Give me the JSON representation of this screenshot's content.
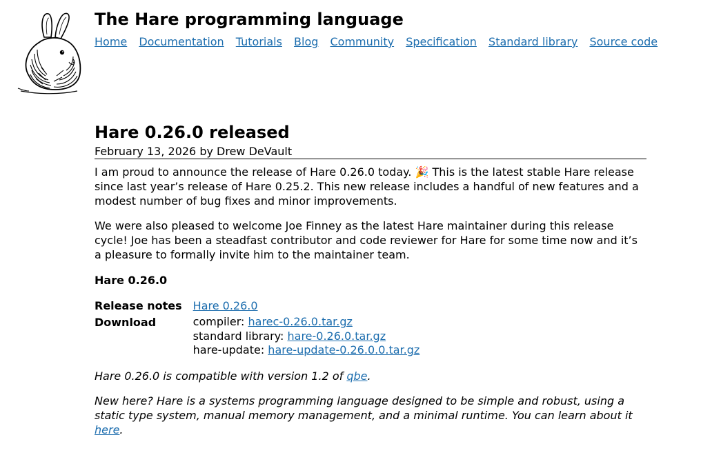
{
  "site": {
    "title": "The Hare programming language",
    "logo_icon": "hare-rabbit-logo"
  },
  "nav": {
    "items": [
      {
        "label": "Home"
      },
      {
        "label": "Documentation"
      },
      {
        "label": "Tutorials"
      },
      {
        "label": "Blog"
      },
      {
        "label": "Community"
      },
      {
        "label": "Specification"
      },
      {
        "label": "Standard library"
      },
      {
        "label": "Source code"
      }
    ]
  },
  "post": {
    "title": "Hare 0.26.0 released",
    "byline": "February 13, 2026 by Drew DeVault",
    "para1": "I am proud to announce the release of Hare 0.26.0 today. 🎉 This is the latest stable Hare release since last year’s release of Hare 0.25.2. This new release includes a handful of new features and a modest number of bug fixes and minor improvements.",
    "para2": "We were also pleased to welcome Joe Finney as the latest Hare maintainer during this release cycle! Joe has been a steadfast contributor and code reviewer for Hare for some time now and it’s a pleasure to formally invite him to the maintainer team.",
    "release_heading": "Hare 0.26.0",
    "release_notes_label": "Release notes",
    "release_notes_link": "Hare 0.26.0",
    "download_label": "Download",
    "downloads": [
      {
        "prefix": "compiler: ",
        "link": "harec-0.26.0.tar.gz"
      },
      {
        "prefix": "standard library: ",
        "link": "hare-0.26.0.tar.gz"
      },
      {
        "prefix": "hare-update: ",
        "link": "hare-update-0.26.0.0.tar.gz"
      }
    ],
    "compat_before": "Hare 0.26.0 is compatible with version 1.2 of ",
    "compat_link": "qbe",
    "compat_after": ".",
    "newhere_text": "New here? Hare is a systems programming language designed to be simple and robust, using a static type system, manual memory management, and a minimal runtime. You can learn about it ",
    "newhere_link": "here",
    "newhere_after": "."
  },
  "colors": {
    "link": "#1c6dae",
    "text": "#000000",
    "background": "#ffffff"
  }
}
